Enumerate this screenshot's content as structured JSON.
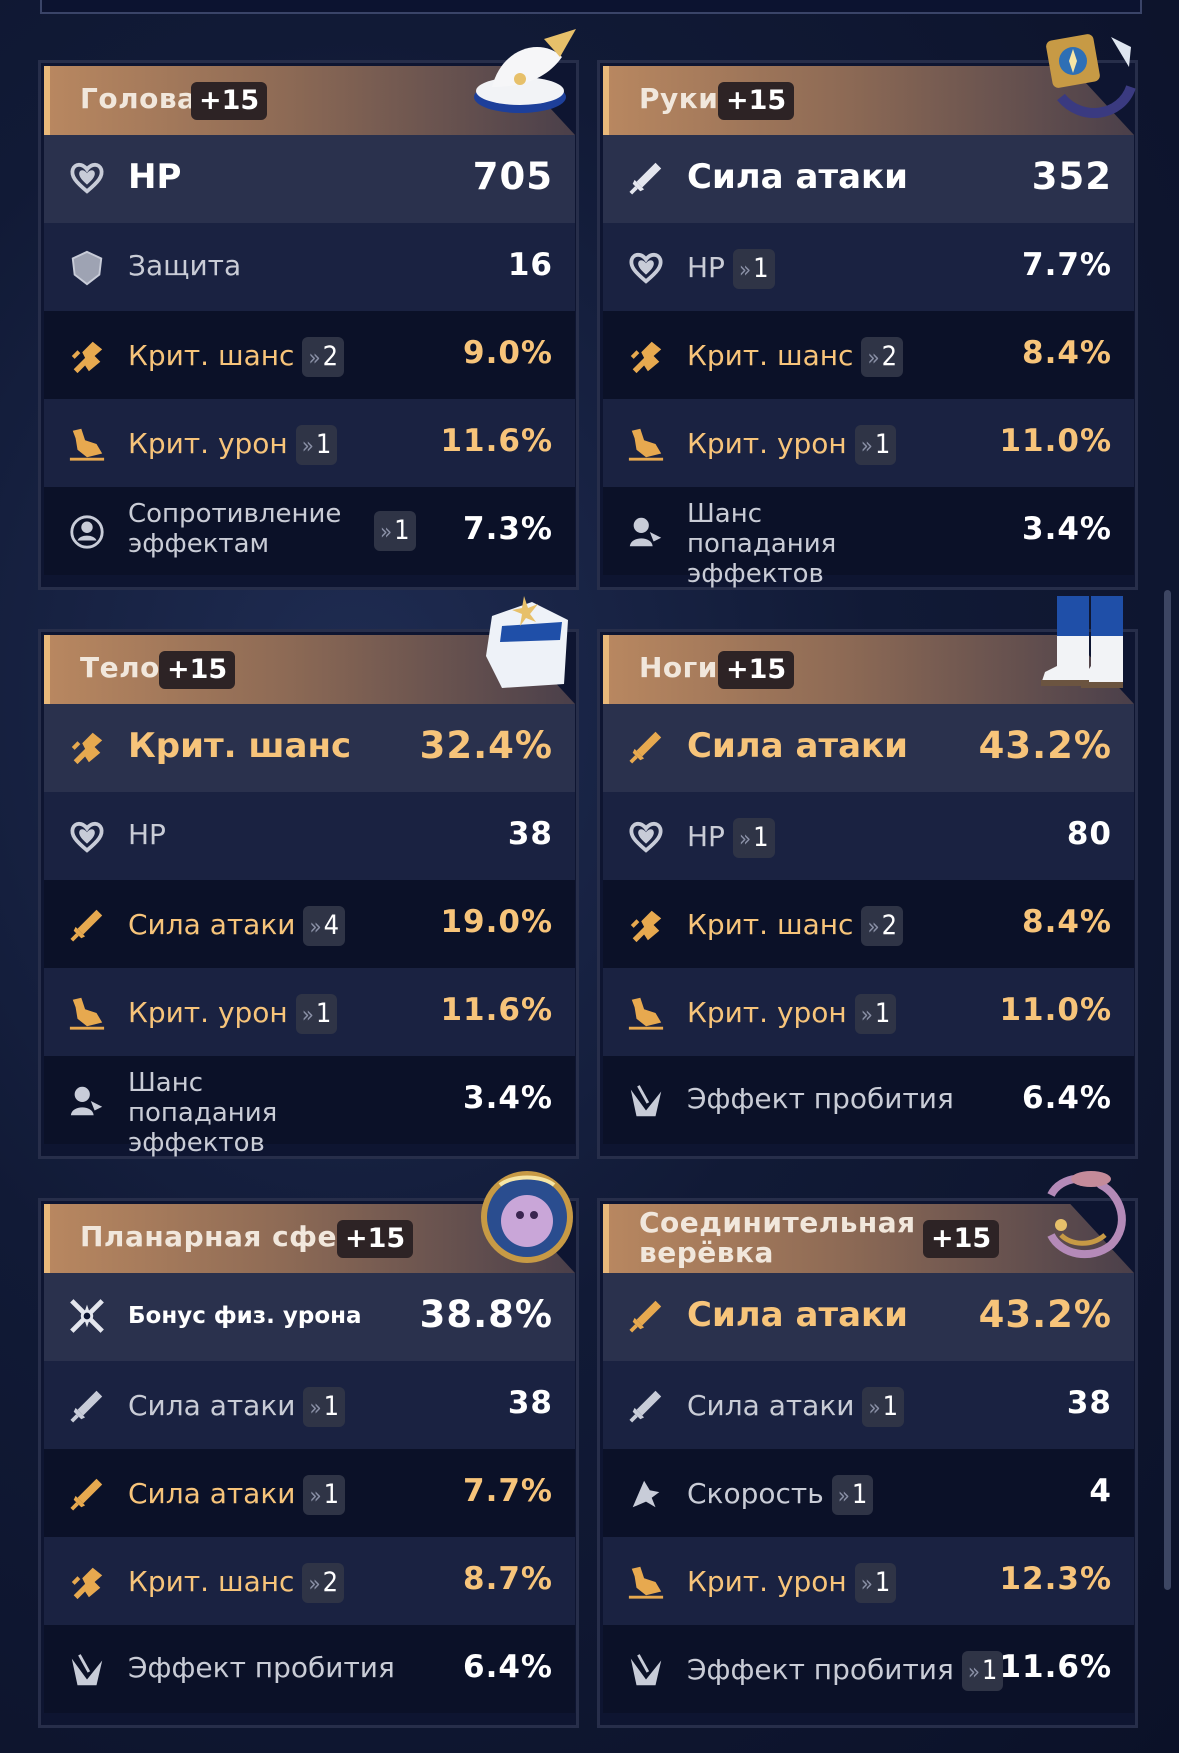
{
  "colors": {
    "accent_gold": "#f7c47a",
    "header_gradient_start": "#b88760",
    "panel_bg": "#0e1531"
  },
  "pieces": [
    {
      "slot": "Голова",
      "level": "+15",
      "icon": "hat-icon",
      "main": {
        "name": "HP",
        "value": "705",
        "icon": "hp-heart-icon",
        "highlight": false
      },
      "subs": [
        {
          "name": "Защита",
          "rolls": "",
          "value": "16",
          "icon": "defense-shield-icon",
          "highlight": false
        },
        {
          "name": "Крит. шанс",
          "rolls": "2",
          "value": "9.0%",
          "icon": "crit-rate-icon",
          "highlight": true
        },
        {
          "name": "Крит. урон",
          "rolls": "1",
          "value": "11.6%",
          "icon": "crit-dmg-icon",
          "highlight": true
        },
        {
          "name": "Сопротивление эффектам",
          "rolls": "1",
          "value": "7.3%",
          "icon": "effect-res-icon",
          "highlight": false
        }
      ]
    },
    {
      "slot": "Руки",
      "level": "+15",
      "icon": "gloves-icon",
      "main": {
        "name": "Сила атаки",
        "value": "352",
        "icon": "attack-sword-icon",
        "highlight": false
      },
      "subs": [
        {
          "name": "HP",
          "rolls": "1",
          "value": "7.7%",
          "icon": "hp-heart-icon",
          "highlight": false
        },
        {
          "name": "Крит. шанс",
          "rolls": "2",
          "value": "8.4%",
          "icon": "crit-rate-icon",
          "highlight": true
        },
        {
          "name": "Крит. урон",
          "rolls": "1",
          "value": "11.0%",
          "icon": "crit-dmg-icon",
          "highlight": true
        },
        {
          "name": "Шанс попадания эффектов",
          "rolls": "",
          "value": "3.4%",
          "icon": "effect-hit-icon",
          "highlight": false
        }
      ]
    },
    {
      "slot": "Тело",
      "level": "+15",
      "icon": "body-armor-icon",
      "main": {
        "name": "Крит. шанс",
        "value": "32.4%",
        "icon": "crit-rate-icon",
        "highlight": true
      },
      "subs": [
        {
          "name": "HP",
          "rolls": "",
          "value": "38",
          "icon": "hp-heart-icon",
          "highlight": false
        },
        {
          "name": "Сила атаки",
          "rolls": "4",
          "value": "19.0%",
          "icon": "attack-sword-icon",
          "highlight": true
        },
        {
          "name": "Крит. урон",
          "rolls": "1",
          "value": "11.6%",
          "icon": "crit-dmg-icon",
          "highlight": true
        },
        {
          "name": "Шанс попадания эффектов",
          "rolls": "",
          "value": "3.4%",
          "icon": "effect-hit-icon",
          "highlight": false
        }
      ]
    },
    {
      "slot": "Ноги",
      "level": "+15",
      "icon": "boots-icon",
      "main": {
        "name": "Сила атаки",
        "value": "43.2%",
        "icon": "attack-sword-icon",
        "highlight": true
      },
      "subs": [
        {
          "name": "HP",
          "rolls": "1",
          "value": "80",
          "icon": "hp-heart-icon",
          "highlight": false
        },
        {
          "name": "Крит. шанс",
          "rolls": "2",
          "value": "8.4%",
          "icon": "crit-rate-icon",
          "highlight": true
        },
        {
          "name": "Крит. урон",
          "rolls": "1",
          "value": "11.0%",
          "icon": "crit-dmg-icon",
          "highlight": true
        },
        {
          "name": "Эффект пробития",
          "rolls": "",
          "value": "6.4%",
          "icon": "break-effect-icon",
          "highlight": false
        }
      ]
    },
    {
      "slot": "Планарная сфера",
      "level": "+15",
      "icon": "planar-sphere-icon",
      "main": {
        "name": "Бонус физ. урона",
        "value": "38.8%",
        "icon": "physical-dmg-icon",
        "highlight": false,
        "small": true
      },
      "subs": [
        {
          "name": "Сила атаки",
          "rolls": "1",
          "value": "38",
          "icon": "attack-sword-icon",
          "highlight": false
        },
        {
          "name": "Сила атаки",
          "rolls": "1",
          "value": "7.7%",
          "icon": "attack-sword-icon",
          "highlight": true
        },
        {
          "name": "Крит. шанс",
          "rolls": "2",
          "value": "8.7%",
          "icon": "crit-rate-icon",
          "highlight": true
        },
        {
          "name": "Эффект пробития",
          "rolls": "",
          "value": "6.4%",
          "icon": "break-effect-icon",
          "highlight": false
        }
      ]
    },
    {
      "slot": "Соединительная верёвка",
      "level": "+15",
      "icon": "link-rope-icon",
      "main": {
        "name": "Сила атаки",
        "value": "43.2%",
        "icon": "attack-sword-icon",
        "highlight": true
      },
      "subs": [
        {
          "name": "Сила атаки",
          "rolls": "1",
          "value": "38",
          "icon": "attack-sword-icon",
          "highlight": false
        },
        {
          "name": "Скорость",
          "rolls": "1",
          "value": "4",
          "icon": "speed-icon",
          "highlight": false
        },
        {
          "name": "Крит. урон",
          "rolls": "1",
          "value": "12.3%",
          "icon": "crit-dmg-icon",
          "highlight": true
        },
        {
          "name": "Эффект пробития",
          "rolls": "1",
          "value": "11.6%",
          "icon": "break-effect-icon",
          "highlight": false
        }
      ]
    }
  ]
}
